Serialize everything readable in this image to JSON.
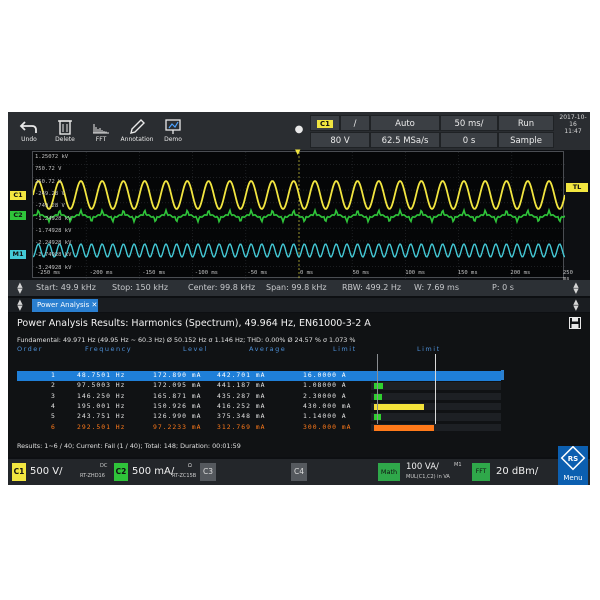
{
  "toolbar": {
    "buttons": [
      {
        "label": "Undo",
        "icon": "undo-icon"
      },
      {
        "label": "Delete",
        "icon": "trash-icon"
      },
      {
        "label": "FFT",
        "icon": "fft-icon"
      },
      {
        "label": "Annotation",
        "icon": "pen-icon"
      },
      {
        "label": "Demo",
        "icon": "demo-icon"
      }
    ],
    "channel_badge": "C1",
    "trigger_edge": "/",
    "voltage": "80 V",
    "mode": "Auto",
    "sample_rate": "62.5 MSa/s",
    "timebase": "50 ms/",
    "offset": "0 s",
    "run_label": "Run",
    "acq_label": "Sample",
    "date": "2017-10-16",
    "time": "11:47"
  },
  "graticule": {
    "y_labels": [
      "1.25072 kV",
      "750.72 V",
      "250.72 V",
      "-249.28 V",
      "-749.28 V",
      "-1.24928 kV",
      "-1.74928 kV",
      "-2.24928 kV",
      "-2.74928 kV",
      "-3.24928 kV"
    ],
    "x_labels": [
      "-250 ms",
      "-200 ms",
      "-150 ms",
      "-100 ms",
      "-50 ms",
      "0 ms",
      "50 ms",
      "100 ms",
      "150 ms",
      "200 ms",
      "250 ms"
    ],
    "channel_tags": [
      "C1",
      "C2",
      "M1"
    ],
    "trigger_tag": "TL"
  },
  "spanbar": {
    "start": "Start: 49.9 kHz",
    "stop": "Stop: 150 kHz",
    "center": "Center: 99.8 kHz",
    "span": "Span: 99.8 kHz",
    "rbw": "RBW: 499.2 Hz",
    "window": "W: 7.69 ms",
    "position": "P: 0 s"
  },
  "tab": {
    "label": "Power Analysis ✕"
  },
  "results": {
    "title": "Power Analysis Results: Harmonics (Spectrum), 49.964 Hz, EN61000-3-2 A",
    "fundamental": "Fundamental: 49.971 Hz (49.95 Hz ~ 60.3 Hz) Ø  50.152 Hz  σ  1.146 Hz;  THD: 0.00% Ø  24.57 % σ 1.073 %",
    "columns": [
      "Order",
      "Frequency",
      "Level",
      "Average",
      "Limit",
      "Limit"
    ],
    "rows": [
      {
        "order": "1",
        "freq": "48.7501 Hz",
        "level": "172.890 mA",
        "avg": "442.701 mA",
        "limit": "16.0000 A",
        "bar": 0.0,
        "color": "#3aa0ff"
      },
      {
        "order": "2",
        "freq": "97.5003 Hz",
        "level": "172.095 mA",
        "avg": "441.187 mA",
        "limit": "1.08000 A",
        "bar": 0.15,
        "color": "#2fd02f"
      },
      {
        "order": "3",
        "freq": "146.250 Hz",
        "level": "165.871 mA",
        "avg": "435.287 mA",
        "limit": "2.30000 A",
        "bar": 0.14,
        "color": "#2fd02f"
      },
      {
        "order": "4",
        "freq": "195.001 Hz",
        "level": "150.926 mA",
        "avg": "416.252 mA",
        "limit": "430.000 mA",
        "bar": 0.84,
        "color": "#f2e23a"
      },
      {
        "order": "5",
        "freq": "243.751 Hz",
        "level": "126.990 mA",
        "avg": "375.348 mA",
        "limit": "1.14000 A",
        "bar": 0.12,
        "color": "#2fd02f"
      },
      {
        "order": "6",
        "freq": "292.501 Hz",
        "level": "97.2233 mA",
        "avg": "312.769 mA",
        "limit": "300.000 mA",
        "bar": 1.0,
        "color": "#ff7a1a"
      }
    ],
    "summary": "Results:  1~6 / 40;  Current: Fail (1 / 40);  Total: 148;  Duration: 00:01:59"
  },
  "bottombar": {
    "c1": {
      "tag": "C1",
      "value": "500 V/",
      "coupling": "DC",
      "probe": "RT-ZHD16"
    },
    "c2": {
      "tag": "C2",
      "value": "500 mA/",
      "coupling": "Ω",
      "probe": "RT-ZC15B"
    },
    "c3": {
      "tag": "C3"
    },
    "c4": {
      "tag": "C4"
    },
    "math": {
      "tag": "Math",
      "value": "100 VA/",
      "formula": "MUL(C1,C2) in VA",
      "label": "M1"
    },
    "fft": {
      "tag": "FFT",
      "value": "20 dBm/"
    },
    "menu": "Menu"
  },
  "colors": {
    "c1": "#f2e640",
    "c2": "#2fc43a",
    "m1": "#44c9d6",
    "accent": "#2a7fd0"
  }
}
